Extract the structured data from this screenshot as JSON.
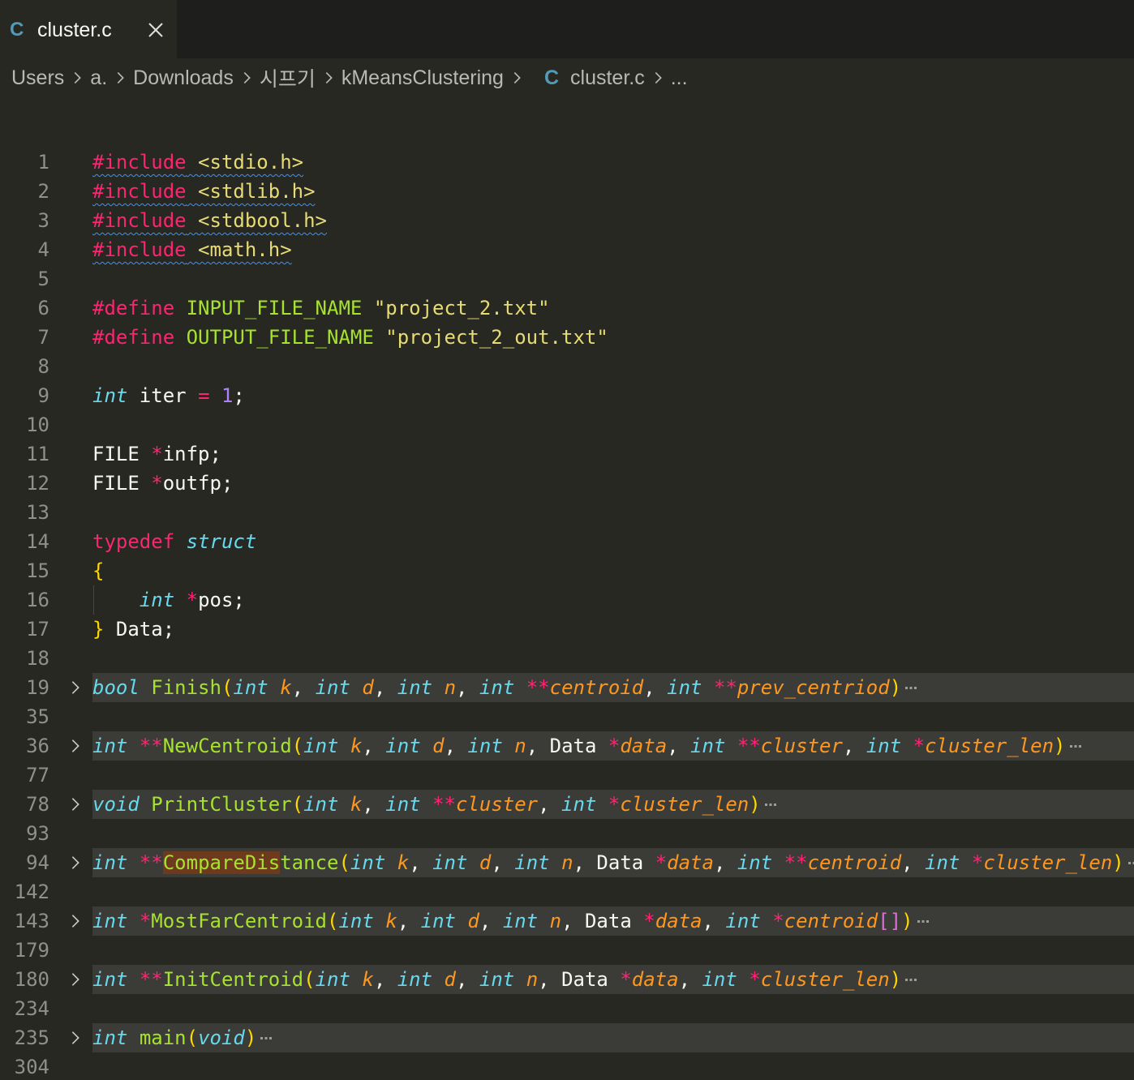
{
  "tab": {
    "icon": "c-file-icon",
    "icon_glyph": "C",
    "label": "cluster.c",
    "close_icon": "close-icon"
  },
  "breadcrumb": {
    "items": [
      "Users",
      "a.",
      "Downloads",
      "시프기",
      "kMeansClustering"
    ],
    "file_icon": "C",
    "file": "cluster.c",
    "more": "..."
  },
  "lines": [
    {
      "n": "1",
      "code": "#include <stdio.h>"
    },
    {
      "n": "2",
      "code": "#include <stdlib.h>"
    },
    {
      "n": "3",
      "code": "#include <stdbool.h>"
    },
    {
      "n": "4",
      "code": "#include <math.h>"
    },
    {
      "n": "5",
      "code": ""
    },
    {
      "n": "6",
      "code": "#define INPUT_FILE_NAME \"project_2.txt\""
    },
    {
      "n": "7",
      "code": "#define OUTPUT_FILE_NAME \"project_2_out.txt\""
    },
    {
      "n": "8",
      "code": ""
    },
    {
      "n": "9",
      "code": "int iter = 1;"
    },
    {
      "n": "10",
      "code": ""
    },
    {
      "n": "11",
      "code": "FILE *infp;"
    },
    {
      "n": "12",
      "code": "FILE *outfp;"
    },
    {
      "n": "13",
      "code": ""
    },
    {
      "n": "14",
      "code": "typedef struct"
    },
    {
      "n": "15",
      "code": "{"
    },
    {
      "n": "16",
      "code": "    int *pos;"
    },
    {
      "n": "17",
      "code": "} Data;"
    },
    {
      "n": "18",
      "code": ""
    },
    {
      "n": "19",
      "code": "bool Finish(int k, int d, int n, int **centroid, int **prev_centriod)",
      "folded": true
    },
    {
      "n": "35",
      "code": ""
    },
    {
      "n": "36",
      "code": "int **NewCentroid(int k, int d, int n, Data *data, int **cluster, int *cluster_len)",
      "folded": true
    },
    {
      "n": "77",
      "code": ""
    },
    {
      "n": "78",
      "code": "void PrintCluster(int k, int **cluster, int *cluster_len)",
      "folded": true
    },
    {
      "n": "93",
      "code": ""
    },
    {
      "n": "94",
      "code": "int **CompareDistance(int k, int d, int n, Data *data, int **centroid, int *cluster_len)",
      "folded": true
    },
    {
      "n": "142",
      "code": ""
    },
    {
      "n": "143",
      "code": "int *MostFarCentroid(int k, int d, int n, Data *data, int *centroid[])",
      "folded": true
    },
    {
      "n": "179",
      "code": ""
    },
    {
      "n": "180",
      "code": "int **InitCentroid(int k, int d, int n, Data *data, int *cluster_len)",
      "folded": true
    },
    {
      "n": "234",
      "code": ""
    },
    {
      "n": "235",
      "code": "int main(void)",
      "folded": true
    },
    {
      "n": "304",
      "code": ""
    }
  ],
  "icons": {
    "fold": "chevron-right-icon",
    "folded_more": "ellipsis-icon",
    "breadcrumb_sep": "chevron-right-icon"
  }
}
